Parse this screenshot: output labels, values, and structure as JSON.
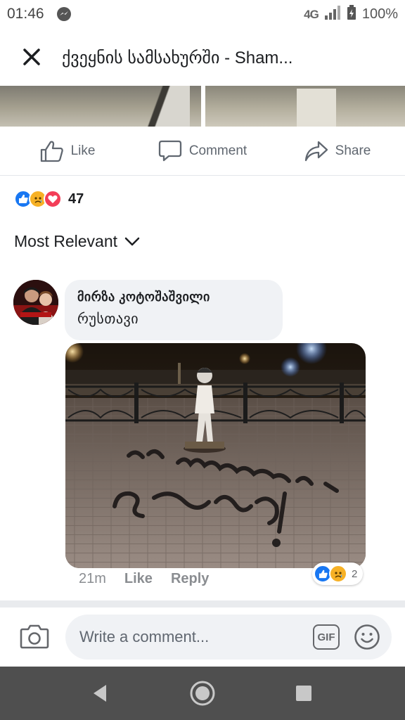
{
  "status_bar": {
    "time": "01:46",
    "network": "4G",
    "battery": "100%"
  },
  "header": {
    "title": "ქვეყნის სამსახურში - Sham..."
  },
  "post_actions": {
    "like_label": "Like",
    "comment_label": "Comment",
    "share_label": "Share"
  },
  "reactions": {
    "types": [
      "like",
      "sad",
      "love"
    ],
    "count": "47"
  },
  "sort": {
    "label": "Most Relevant"
  },
  "comment": {
    "author": "მირზა კოტოშაშვილი",
    "text": "რუსთავი",
    "time": "21m",
    "like_label": "Like",
    "reply_label": "Reply",
    "reaction_types": [
      "like",
      "sad"
    ],
    "reaction_count": "2"
  },
  "composer": {
    "placeholder": "Write a comment...",
    "gif_label": "GIF"
  },
  "colors": {
    "like_blue": "#1877f2",
    "love_red": "#f33e58",
    "sad_yellow": "#f7b125",
    "text_gray": "#606770"
  }
}
